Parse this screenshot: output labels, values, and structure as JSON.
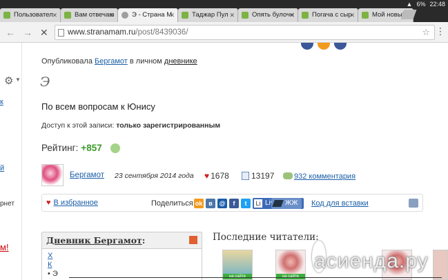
{
  "status_bar": {
    "battery": "6%",
    "time": "22:48"
  },
  "tabs": [
    {
      "label": "Пользовател"
    },
    {
      "label": "Вам отвечаю"
    },
    {
      "label": "Э - Страна М"
    },
    {
      "label": "Таджар Пул"
    },
    {
      "label": "Опять булочн"
    },
    {
      "label": "Погача с сыр"
    },
    {
      "label": "Мой новый р"
    }
  ],
  "address": {
    "domain": "www.stranamam.ru",
    "path": "/post/8439036/"
  },
  "sidebar": {
    "link1": "к",
    "link2": "й",
    "inet": "рнет",
    "red": "м!"
  },
  "post": {
    "published_prefix": "Опубликовала",
    "author": "Бергамот",
    "published_mid": "в личном",
    "diary_word": "дневнике",
    "title": "Э",
    "text": "По всем вопросам к Юнису",
    "access_label": "Доступ к этой записи:",
    "access_value": "только зарегистрированным",
    "rating_label": "Рейтинг:",
    "rating_value": "+857",
    "date": "23 сентября 2014 года",
    "likes": "1678",
    "views": "13197",
    "comments": "932 комментария"
  },
  "share": {
    "favorites": "В избранное",
    "share_label": "Поделиться:",
    "liveinternet": "LiveInternet",
    "zhzh": "ЖЖ",
    "embed": "Код для вставки"
  },
  "diary_box": {
    "title": "Дневник Бергамот",
    "colon": ":",
    "links": [
      "Х",
      "К"
    ],
    "item": "Э"
  },
  "readers": {
    "title": "Последние читатели:",
    "online_label": "на сайте"
  },
  "watermark": "асиенда.ру",
  "colors": {
    "accent": "#1a5ea8",
    "rating": "#3c9a2a"
  }
}
